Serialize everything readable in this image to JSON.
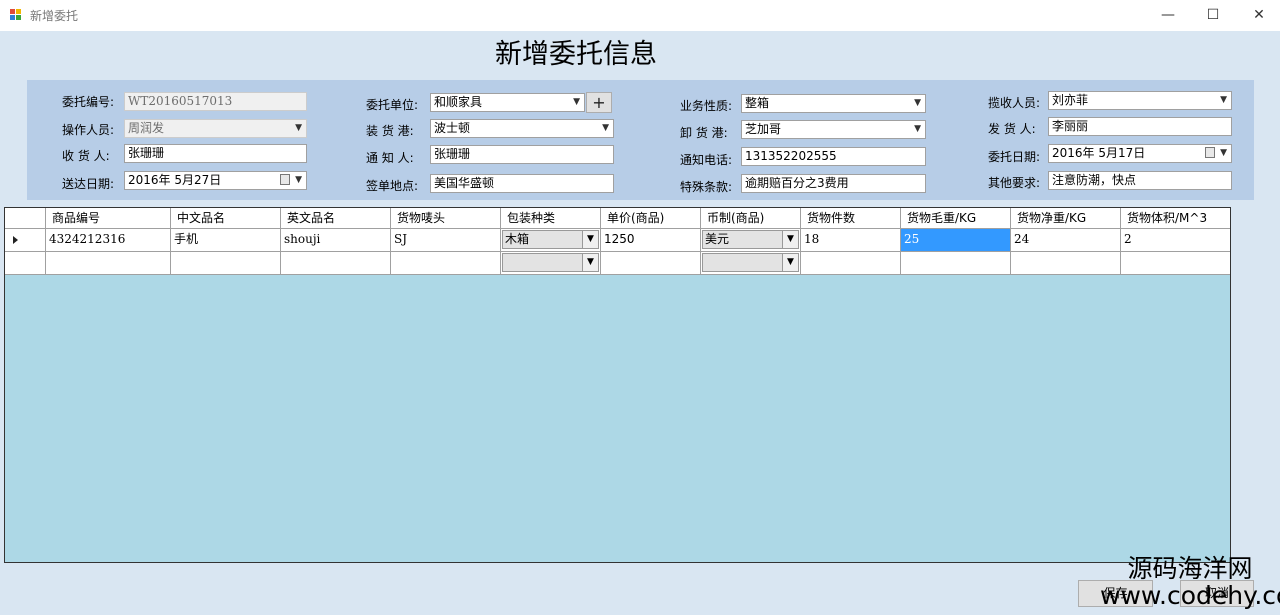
{
  "window": {
    "title": "新增委托",
    "minimize": "—",
    "maximize": "☐",
    "close": "✕"
  },
  "form": {
    "title": "新增委托信息",
    "labels": {
      "consign_no": "委托编号:",
      "operator": "操作人员:",
      "consignee": "收 货 人:",
      "delivery_date": "送达日期:",
      "consign_unit": "委托单位:",
      "load_port": "装 货 港:",
      "notify": "通 知 人:",
      "sign_place": "签单地点:",
      "business_type": "业务性质:",
      "unload_port": "卸 货 港:",
      "notify_phone": "通知电话:",
      "special_terms": "特殊条款:",
      "collector": "揽收人员:",
      "shipper": "发 货 人:",
      "consign_date": "委托日期:",
      "other_req": "其他要求:"
    },
    "values": {
      "consign_no": "WT20160517013",
      "operator": "周润发",
      "consignee": "张珊珊",
      "delivery_date": "2016年 5月27日",
      "consign_unit": "和顺家具",
      "load_port": "波士顿",
      "notify": "张珊珊",
      "sign_place": "美国华盛顿",
      "business_type": "整箱",
      "unload_port": "芝加哥",
      "notify_phone": "131352202555",
      "special_terms": "逾期赔百分之3费用",
      "collector": "刘亦菲",
      "shipper": "李丽丽",
      "consign_date": "2016年 5月17日",
      "other_req": "注意防潮，快点"
    },
    "add_button": "+"
  },
  "grid": {
    "headers": [
      "商品编号",
      "中文品名",
      "英文品名",
      "货物唛头",
      "包装种类",
      "单价(商品)",
      "币制(商品)",
      "货物件数",
      "货物毛重/KG",
      "货物净重/KG",
      "货物体积/M^3"
    ],
    "rows": [
      [
        "4324212316",
        "手机",
        "shouji",
        "SJ",
        "木箱",
        "1250",
        "美元",
        "18",
        "25",
        "24",
        "2"
      ],
      [
        "",
        "",
        "",
        "",
        "",
        "",
        "",
        "",
        "",
        "",
        ""
      ]
    ]
  },
  "buttons": {
    "save": "保存",
    "cancel": "取消"
  },
  "watermark": {
    "line1": "源码海洋网",
    "line2": "www.codehy.com"
  }
}
